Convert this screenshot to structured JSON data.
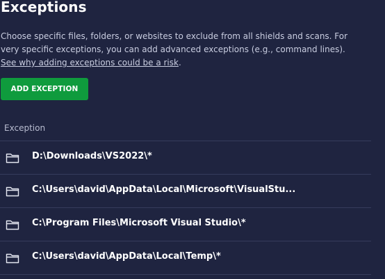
{
  "page": {
    "title": "Exceptions",
    "description_line1": "Choose specific files, folders, or websites to exclude from all shields and scans. For",
    "description_line2": "very specific exceptions, you can add advanced exceptions (e.g., command lines).",
    "help_link": "See why adding exceptions could be a risk",
    "help_link_suffix": ".",
    "add_button_label": "ADD EXCEPTION",
    "column_header": "Exception"
  },
  "exceptions": [
    {
      "icon": "folder-icon",
      "path": "D:\\Downloads\\VS2022\\*"
    },
    {
      "icon": "folder-icon",
      "path": "C:\\Users\\david\\AppData\\Local\\Microsoft\\VisualStu..."
    },
    {
      "icon": "folder-icon",
      "path": "C:\\Program Files\\Microsoft Visual Studio\\*"
    },
    {
      "icon": "folder-icon",
      "path": "C:\\Users\\david\\AppData\\Local\\Temp\\*"
    }
  ],
  "colors": {
    "background": "#1f2440",
    "accent_button": "#0f9b3d",
    "divider": "#363c5c"
  }
}
